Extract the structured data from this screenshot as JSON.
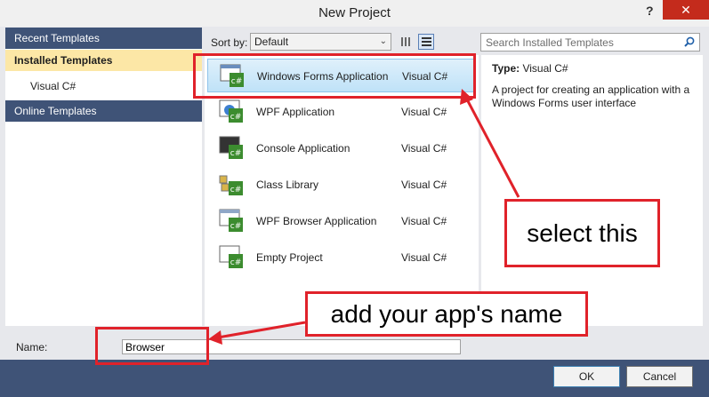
{
  "window": {
    "title": "New Project",
    "help_glyph": "?",
    "close_glyph": "✕"
  },
  "sidebar": {
    "recent": "Recent Templates",
    "installed": "Installed Templates",
    "installed_child": "Visual C#",
    "online": "Online Templates"
  },
  "toolbar": {
    "sort_label": "Sort by:",
    "sort_value": "Default"
  },
  "search": {
    "placeholder": "Search Installed Templates"
  },
  "templates": [
    {
      "name": "Windows Forms Application",
      "lang": "Visual C#"
    },
    {
      "name": "WPF Application",
      "lang": "Visual C#"
    },
    {
      "name": "Console Application",
      "lang": "Visual C#"
    },
    {
      "name": "Class Library",
      "lang": "Visual C#"
    },
    {
      "name": "WPF Browser Application",
      "lang": "Visual C#"
    },
    {
      "name": "Empty Project",
      "lang": "Visual C#"
    }
  ],
  "details": {
    "type_label": "Type:",
    "type_value": "Visual C#",
    "description": "A project for creating an application with a Windows Forms user interface"
  },
  "form": {
    "name_label": "Name:",
    "name_value": "Browser"
  },
  "buttons": {
    "ok": "OK",
    "cancel": "Cancel"
  },
  "annotations": {
    "select": "select this",
    "name": "add your app's name"
  },
  "colors": {
    "accent": "#3f5377",
    "selected": "#fce7a6",
    "annotation": "#e0222a"
  },
  "icon_badge": "c#"
}
